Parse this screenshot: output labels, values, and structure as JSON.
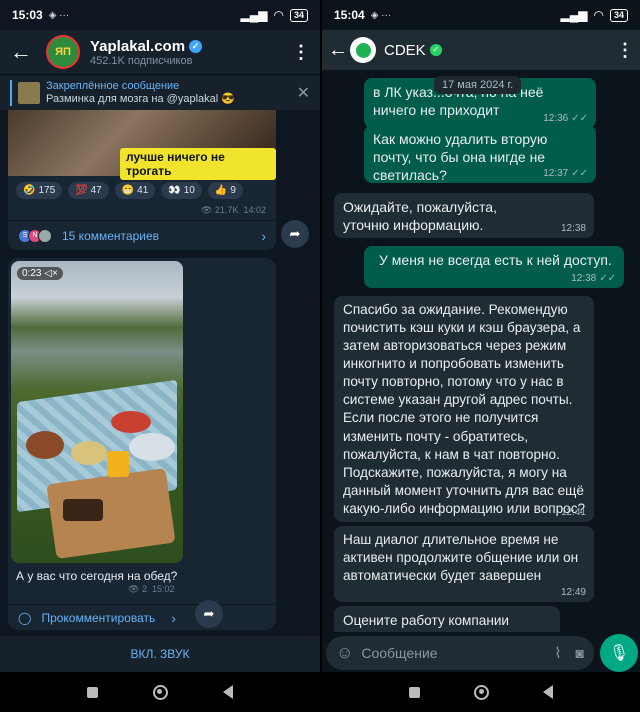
{
  "left": {
    "status": {
      "time": "15:03",
      "battery": "34"
    },
    "header": {
      "title": "Yaplakal.com",
      "subtitle": "452.1K подписчиков",
      "avatar_text": "ЯП"
    },
    "pinned": {
      "title": "Закреплённое сообщение",
      "text": "Разминка для мозга на @yaplakal 😎"
    },
    "post1": {
      "sticker": "лучше ничего не трогать",
      "reactions": [
        {
          "emoji": "🤣",
          "count": "175"
        },
        {
          "emoji": "💯",
          "count": "47"
        },
        {
          "emoji": "😁",
          "count": "41"
        },
        {
          "emoji": "👀",
          "count": "10"
        },
        {
          "emoji": "👍",
          "count": "9"
        }
      ],
      "views": "21.7K",
      "time": "14:02",
      "avatars": [
        "S",
        "N"
      ],
      "comments_label": "15 комментариев"
    },
    "post2": {
      "duration": "0:23",
      "caption": "А у вас что сегодня на обед?",
      "views": "2",
      "time": "15:02",
      "comment_action": "Прокомментировать"
    },
    "unmute_label": "ВКЛ. ЗВУК"
  },
  "right": {
    "status": {
      "time": "15:04",
      "battery": "34"
    },
    "header": {
      "title": "CDEK"
    },
    "date_chip": "17 мая 2024 г.",
    "messages": [
      {
        "dir": "out",
        "text": "в ЛК указ...очта, но на неё ничего не приходит",
        "time": "12:36"
      },
      {
        "dir": "out",
        "text": "Как можно удалить вторую почту, что бы она нигде не светилась?",
        "time": "12:37"
      },
      {
        "dir": "in",
        "text": "Ожидайте, пожалуйста, уточню информацию.",
        "time": "12:38"
      },
      {
        "dir": "out",
        "text": "У меня не всегда есть к ней доступ.",
        "time": "12:38"
      },
      {
        "dir": "in",
        "text": "Спасибо за ожидание. Рекомендую почистить кэш куки и кэш браузера, а затем авторизоваться через режим инкогнито и попробовать изменить почту повторно, потому что у нас в системе указан другой адрес почты. Если после этого не получится изменить почту - обратитесь, пожалуйста, к нам в чат повторно. Подскажите, пожалуйста, я могу на данный момент уточнить для вас ещё какую-либо информацию или вопрос?",
        "time": "12:41"
      },
      {
        "dir": "in",
        "text": "Наш диалог длительное время не активен продолжите общение или он автоматически будет завершен",
        "time": "12:49"
      },
      {
        "dir": "in",
        "text": "Оцените работу компании CDEK.",
        "time": ""
      }
    ],
    "composer": {
      "placeholder": "Сообщение"
    }
  }
}
